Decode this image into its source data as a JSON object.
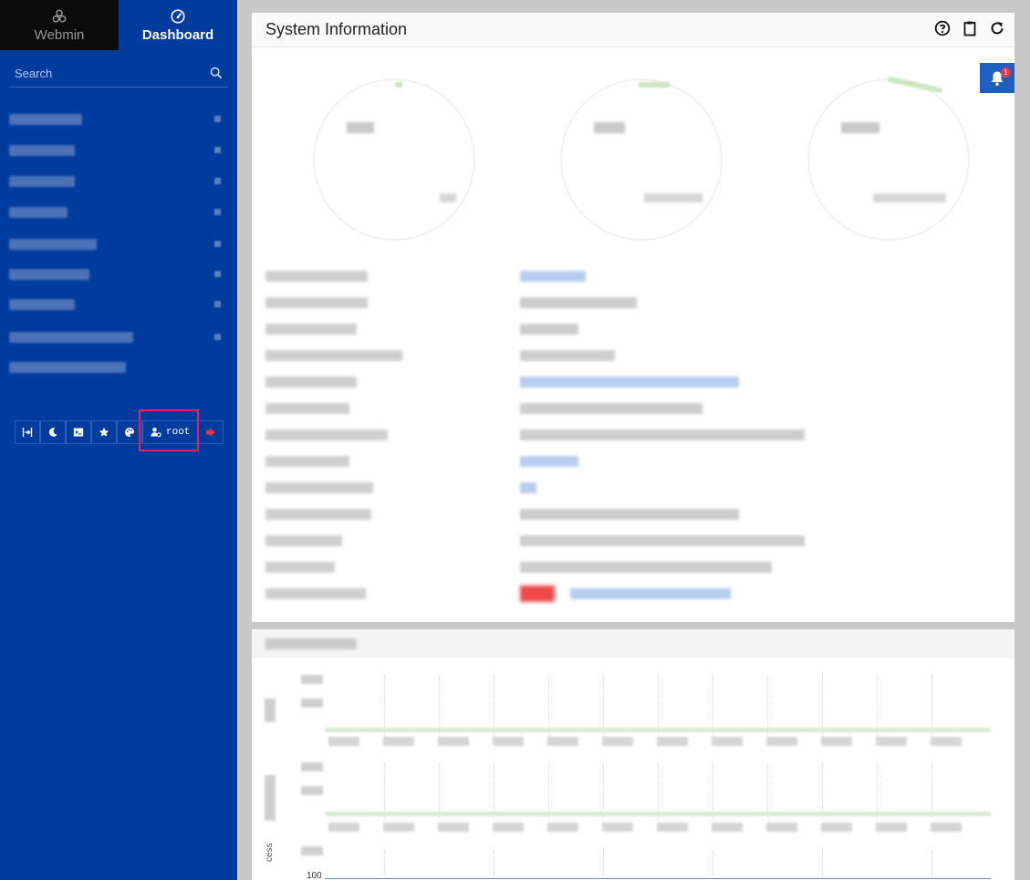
{
  "sidebar": {
    "tabs": [
      {
        "label": "Webmin",
        "icon": "webmin-logo-icon"
      },
      {
        "label": "Dashboard",
        "icon": "dashboard-gauge-icon"
      }
    ],
    "search": {
      "placeholder": "Search",
      "value": ""
    },
    "menu_items": [
      {
        "label": "",
        "icon": "chevron-icon"
      },
      {
        "label": "",
        "icon": "chevron-icon"
      },
      {
        "label": "",
        "icon": "chevron-icon"
      },
      {
        "label": "",
        "icon": "chevron-icon"
      },
      {
        "label": "",
        "icon": "chevron-icon"
      },
      {
        "label": "",
        "icon": "chevron-icon"
      },
      {
        "label": "",
        "icon": "chevron-icon"
      },
      {
        "label": "",
        "icon": "chevron-icon"
      },
      {
        "label": "",
        "icon": "chevron-icon"
      }
    ],
    "bottom_bar": {
      "user_label": "root",
      "icons": [
        "collapse-icon",
        "moon-icon",
        "terminal-icon",
        "star-icon",
        "palette-icon",
        "user-cog-icon",
        "logout-icon"
      ]
    }
  },
  "panel1": {
    "title": "System Information",
    "head_icons": [
      "help-icon",
      "clipboard-icon",
      "refresh-icon"
    ],
    "notification_count": "1"
  },
  "chart_axis": {
    "value_100": "100",
    "y_label_partial": "cess"
  },
  "colors": {
    "sidebar_bg": "#003b9e",
    "webmin_tab_bg": "#0b0b0b",
    "highlight": "#e0245e",
    "notif_bg": "#1e5fbf",
    "badge": "#e63946"
  }
}
